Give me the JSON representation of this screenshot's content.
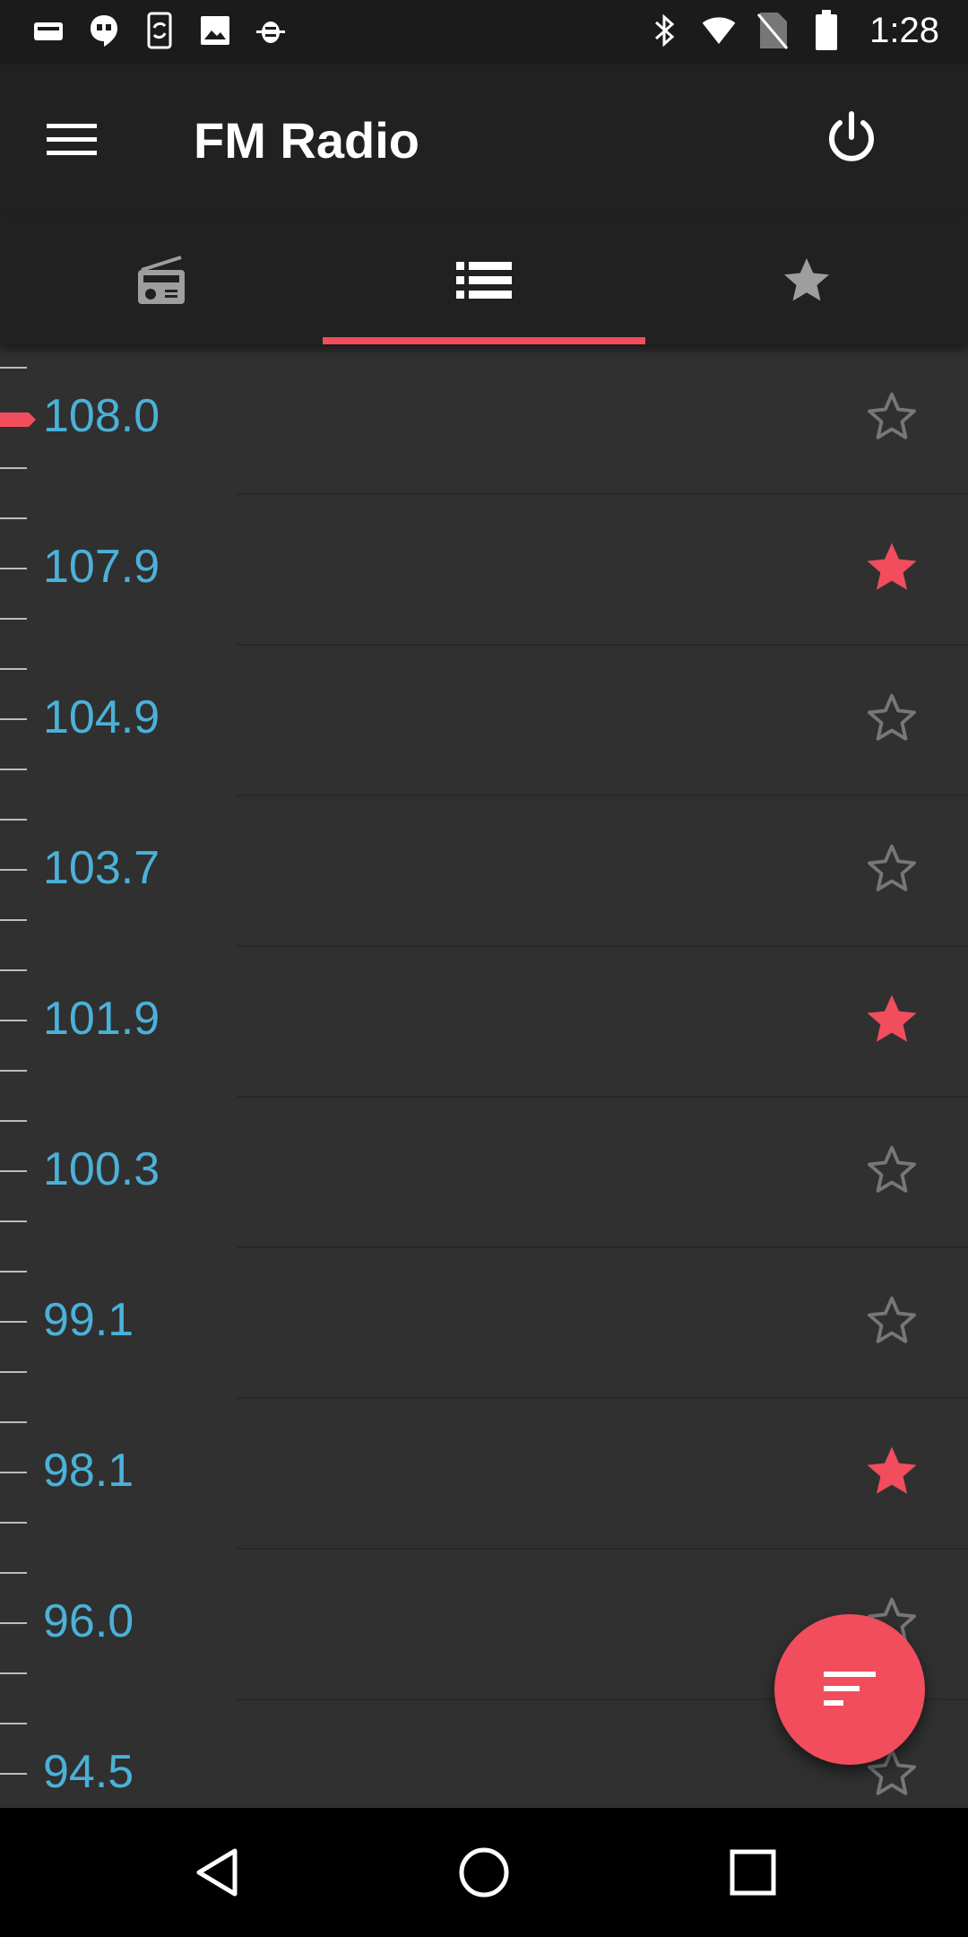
{
  "status_bar": {
    "time": "1:28",
    "left_icons": [
      "card-icon",
      "hangouts-icon",
      "phone-sync-icon",
      "image-icon",
      "bug-icon"
    ],
    "right_icons": [
      "bluetooth-icon",
      "wifi-icon",
      "no-sim-icon",
      "battery-icon"
    ]
  },
  "toolbar": {
    "title": "FM Radio"
  },
  "tabs": [
    {
      "icon": "radio-icon",
      "selected": false
    },
    {
      "icon": "list-icon",
      "selected": true
    },
    {
      "icon": "star-icon",
      "selected": false
    }
  ],
  "stations": [
    {
      "freq": "108.0",
      "favorite": false
    },
    {
      "freq": "107.9",
      "favorite": true
    },
    {
      "freq": "104.9",
      "favorite": false
    },
    {
      "freq": "103.7",
      "favorite": false
    },
    {
      "freq": "101.9",
      "favorite": true
    },
    {
      "freq": "100.3",
      "favorite": false
    },
    {
      "freq": "99.1",
      "favorite": false
    },
    {
      "freq": "98.1",
      "favorite": true
    },
    {
      "freq": "96.0",
      "favorite": false
    },
    {
      "freq": "94.5",
      "favorite": false
    }
  ],
  "fab": {
    "icon": "sort-icon"
  },
  "nav_bar": {
    "icons": [
      "back-icon",
      "home-icon",
      "recents-icon"
    ]
  },
  "colors": {
    "accent": "#f14d5c",
    "frequency_text": "#4bb1d8",
    "toolbar": "#212121",
    "background": "#303030",
    "star_outline": "#777777"
  }
}
